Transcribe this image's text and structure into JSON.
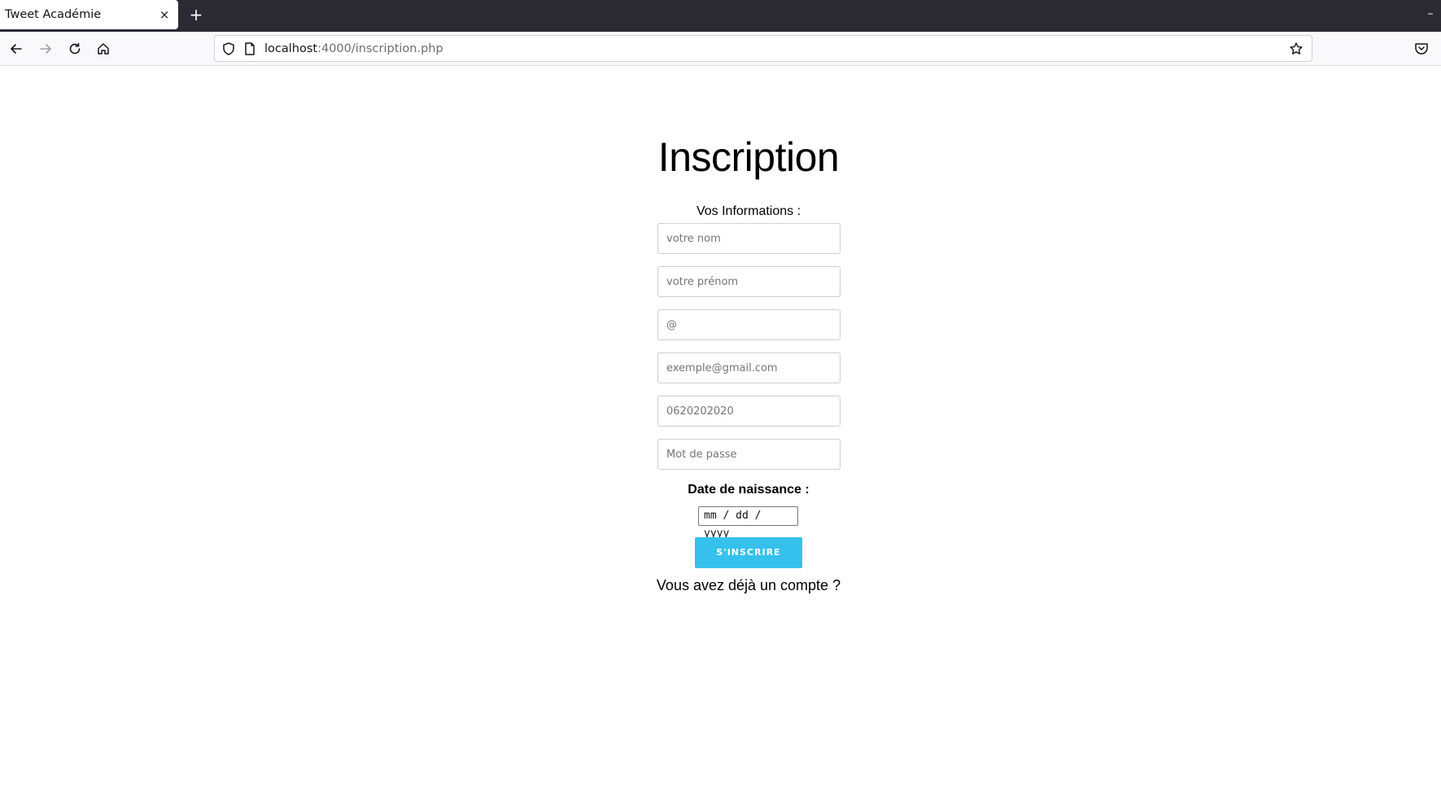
{
  "browser": {
    "tab_title": "Tweet Académie",
    "tab_close": "×",
    "new_tab": "+",
    "window_minimize": "–",
    "url_host": "localhost",
    "url_rest": ":4000/inscription.php"
  },
  "form": {
    "title": "Inscription",
    "section_label": "Vos Informations :",
    "fields": {
      "nom": {
        "placeholder": "votre nom"
      },
      "prenom": {
        "placeholder": "votre prénom"
      },
      "at": {
        "placeholder": "@"
      },
      "email": {
        "placeholder": "exemple@gmail.com"
      },
      "phone": {
        "placeholder": "0620202020"
      },
      "password": {
        "placeholder": "Mot de passe"
      }
    },
    "dob_label": "Date de naissance :",
    "dob_placeholder": "mm / dd / yyyy",
    "submit_label": "S'INSCRIRE",
    "login_link": "Vous avez déjà un compte ?"
  },
  "colors": {
    "accent": "#35c1ec",
    "tabbar": "#2b2a33"
  }
}
